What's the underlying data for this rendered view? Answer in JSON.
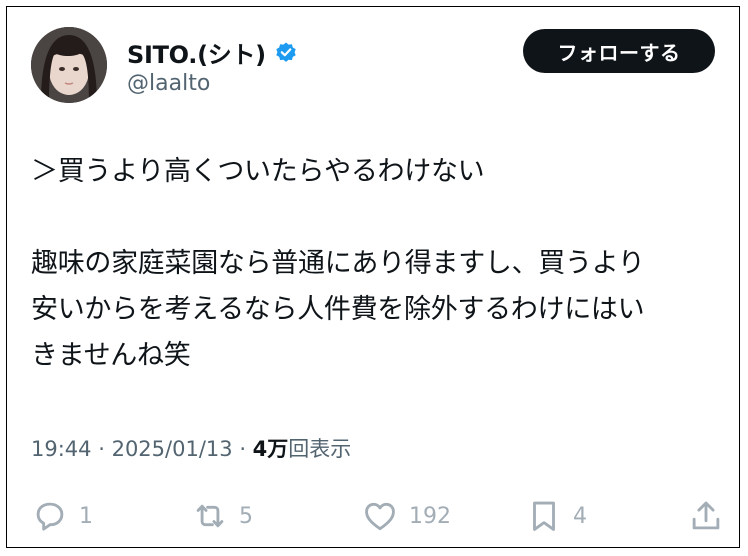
{
  "user": {
    "display_name": "SITO.(シト)",
    "handle": "@laalto",
    "verified": true
  },
  "follow_button": {
    "label": "フォローする"
  },
  "tweet": {
    "text": "＞買うより高くついたらやるわけない\n\n趣味の家庭菜園なら普通にあり得ますし、買うより\n安いからを考えるなら人件費を除外するわけにはい\nきませんね笑",
    "time": "19:44",
    "date": "2025/01/13",
    "views_number": "4万",
    "views_label": "回表示"
  },
  "actions": {
    "reply": {
      "icon": "reply-icon",
      "count": "1"
    },
    "retweet": {
      "icon": "retweet-icon",
      "count": "5"
    },
    "like": {
      "icon": "heart-icon",
      "count": "192"
    },
    "bookmark": {
      "icon": "bookmark-icon",
      "count": "4"
    },
    "share": {
      "icon": "share-icon"
    }
  },
  "colors": {
    "text_primary": "#0f1419",
    "text_secondary": "#536471",
    "action_icon": "#a3adb6",
    "verified_badge": "#1d9bf0",
    "button_bg": "#0f1419"
  }
}
